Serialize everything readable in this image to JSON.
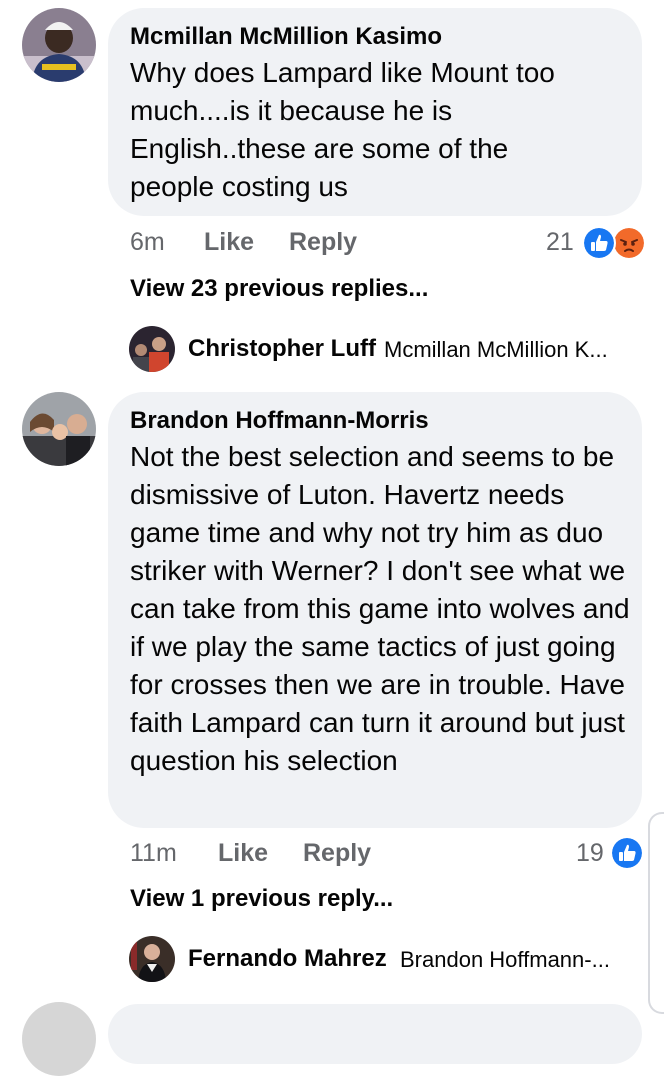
{
  "comments": [
    {
      "author": "Mcmillan McMillion Kasimo",
      "text": "Why does Lampard like Mount too much....is it because he is English..these are some of the people costing us",
      "time": "6m",
      "like_label": "Like",
      "reply_label": "Reply",
      "reaction_count": "21",
      "reactions": [
        "like-reaction-icon",
        "angry-reaction-icon"
      ],
      "view_replies": "View 23 previous replies...",
      "latest_reply": {
        "author": "Christopher Luff",
        "snippet": "Mcmillan McMillion K..."
      }
    },
    {
      "author": "Brandon Hoffmann-Morris",
      "text": "Not the best selection and seems to be dismissive of Luton. Havertz needs game time and why not try him as duo striker with Werner? I don't see what we can take from this game into wolves and if we play the same tactics of just going for crosses then we are in trouble. Have faith Lampard can turn it around but just question his selection",
      "time": "11m",
      "like_label": "Like",
      "reply_label": "Reply",
      "reaction_count": "19",
      "reactions": [
        "like-reaction-icon"
      ],
      "view_replies": "View 1 previous reply...",
      "latest_reply": {
        "author": "Fernando Mahrez",
        "snippet": "Brandon Hoffmann-..."
      }
    }
  ],
  "colors": {
    "bubble": "#f0f2f5",
    "meta_text": "#65676b",
    "like_blue": "#1877f2",
    "angry_orange": "#f26a2a"
  }
}
